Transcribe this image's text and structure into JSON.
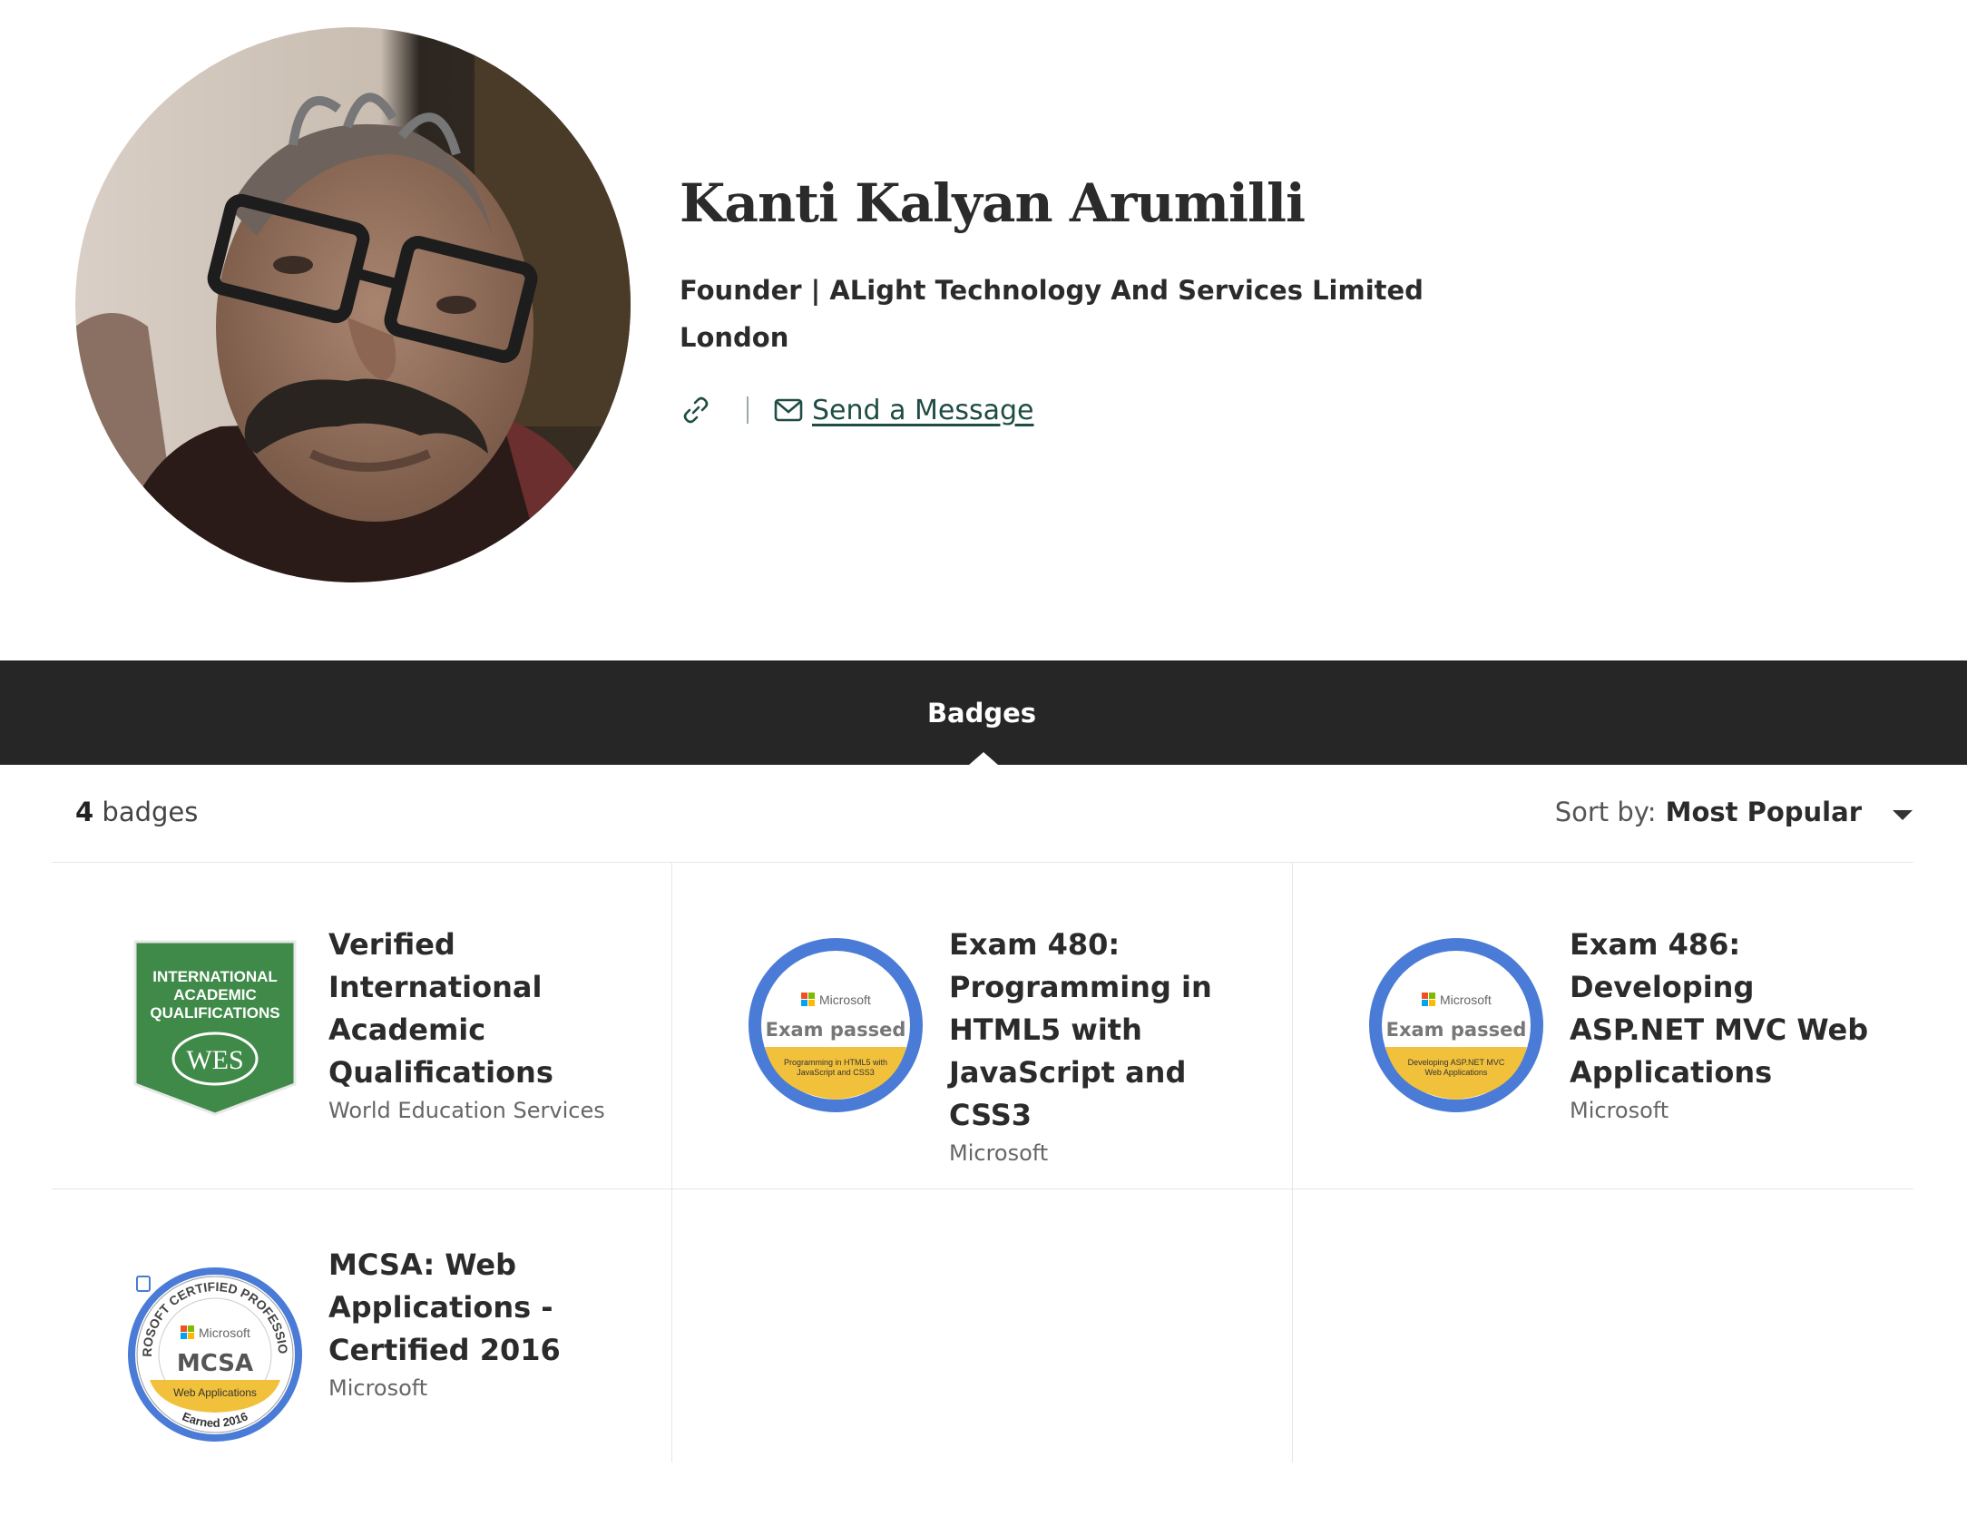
{
  "profile": {
    "name": "Kanti Kalyan Arumilli",
    "title": "Founder | ALight Technology And Services Limited",
    "location": "London",
    "send_message_label": "Send a Message"
  },
  "tabs": [
    {
      "label": "Badges",
      "active": true
    }
  ],
  "badges_summary": {
    "count": "4",
    "count_suffix": " badges",
    "sort_label": "Sort by:",
    "sort_value": "Most Popular"
  },
  "badges": [
    {
      "title": "Verified International Academic Qualifications",
      "issuer": "World Education Services",
      "image": {
        "line1": "INTERNATIONAL",
        "line2": "ACADEMIC",
        "line3": "QUALIFICATIONS",
        "logo": "WES"
      }
    },
    {
      "title": "Exam 480: Programming in HTML5 with JavaScript and CSS3",
      "issuer": "Microsoft",
      "image": {
        "brand": "Microsoft",
        "status": "Exam passed",
        "ribbon1": "Programming in HTML5 with",
        "ribbon2": "JavaScript and CSS3"
      }
    },
    {
      "title": "Exam 486: Developing ASP.NET MVC Web Applications",
      "issuer": "Microsoft",
      "image": {
        "brand": "Microsoft",
        "status": "Exam passed",
        "ribbon1": "Developing ASP.NET MVC",
        "ribbon2": "Web Applications"
      }
    },
    {
      "title": "MCSA: Web Applications - Certified 2016",
      "issuer": "Microsoft",
      "image": {
        "brand": "Microsoft",
        "status": "MCSA",
        "ribbon1": "Web Applications",
        "ring_text": "MICROSOFT CERTIFIED PROFESSIONAL",
        "earned": "Earned 2016"
      }
    }
  ],
  "colors": {
    "tabbar": "#262626",
    "link": "#1f4d45",
    "wes_green": "#3f8a48",
    "ms_blue": "#4a7bd6",
    "ms_yellow": "#f2c13b"
  }
}
